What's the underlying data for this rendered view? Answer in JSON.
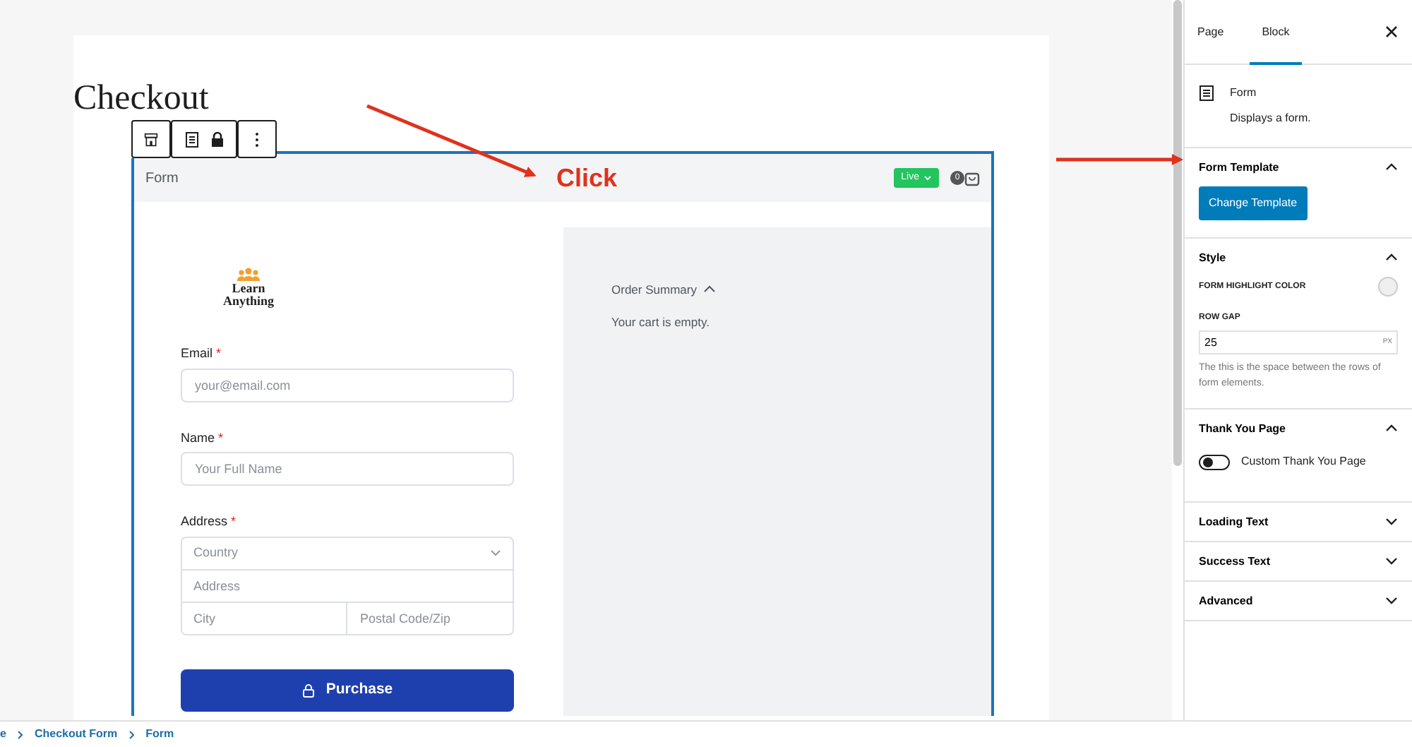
{
  "page": {
    "title": "Checkout"
  },
  "annotation": {
    "label": "Click"
  },
  "form_block": {
    "header": "Form",
    "status": "Live",
    "cart_count": "0",
    "logo": {
      "line_1": "Learn",
      "line_2": "Anything"
    },
    "fields": [
      {
        "label": "Email",
        "required_mark": "*",
        "placeholder": "your@email.com"
      },
      {
        "label": "Name",
        "required_mark": "*",
        "placeholder": "Your Full Name"
      }
    ],
    "address": {
      "label": "Address",
      "required_mark": "*",
      "country_placeholder": "Country",
      "address_placeholder": "Address",
      "city_placeholder": "City",
      "postal_placeholder": "Postal Code/Zip"
    },
    "purchase_button": "Purchase",
    "order_summary": {
      "title": "Order Summary",
      "expanded": true,
      "message": "Your cart is empty."
    }
  },
  "sidebar": {
    "tabs": [
      {
        "label": "Page",
        "selected": false
      },
      {
        "label": "Block",
        "selected": true
      }
    ],
    "block": {
      "name": "Form",
      "description": "Displays a form."
    },
    "panels": [
      {
        "kind": "template",
        "title": "Form Template",
        "expanded": true,
        "button": "Change Template"
      },
      {
        "kind": "style",
        "title": "Style",
        "expanded": true,
        "color_label": "FORM HIGHLIGHT COLOR",
        "gap_label": "ROW GAP",
        "gap_value": "25",
        "gap_unit": "PX",
        "help": "The this is the space between the rows of form elements."
      },
      {
        "kind": "toggle",
        "title": "Thank You Page",
        "expanded": true,
        "toggle_label": "Custom Thank You Page",
        "on": false
      },
      {
        "title": "Loading Text",
        "expanded": false
      },
      {
        "title": "Success Text",
        "expanded": false
      },
      {
        "title": "Advanced",
        "expanded": false
      }
    ]
  },
  "breadcrumbs": [
    "e",
    "Checkout Form",
    "Form"
  ]
}
